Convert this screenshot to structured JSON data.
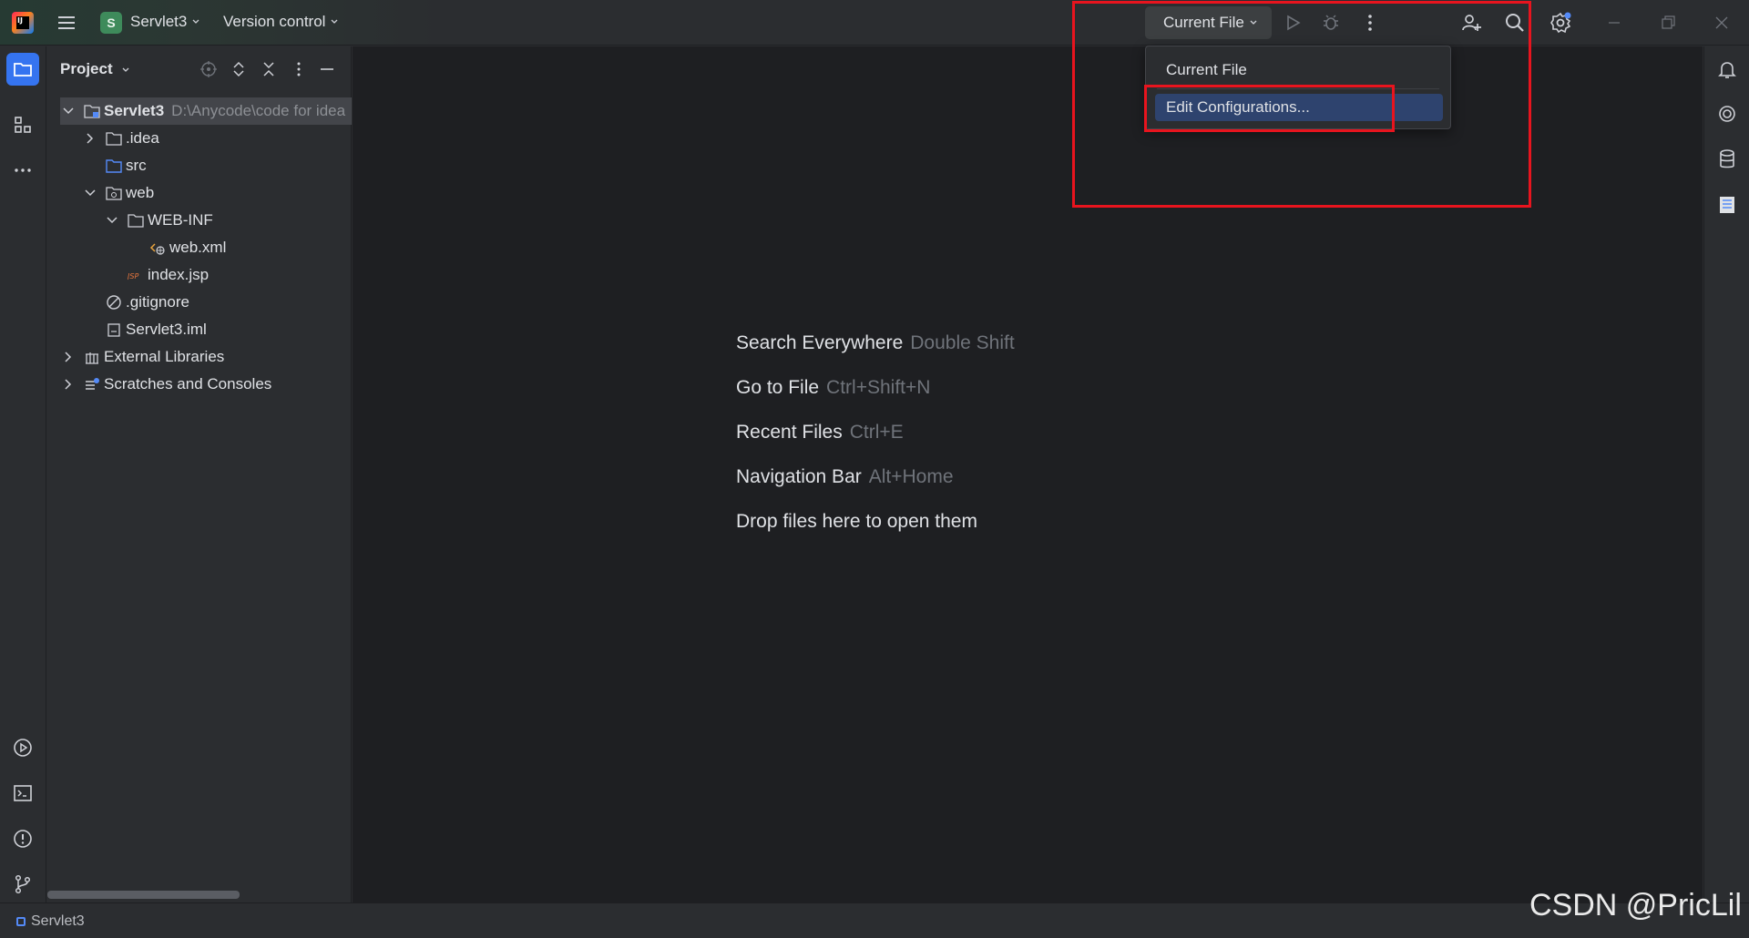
{
  "title_bar": {
    "project_badge": "S",
    "project_name": "Servlet3",
    "version_control_label": "Version control",
    "run_config_label": "Current File"
  },
  "run_config_popup": {
    "items": [
      {
        "label": "Current File",
        "selected": false
      },
      {
        "label": "Edit Configurations...",
        "selected": true
      }
    ]
  },
  "project_panel": {
    "title": "Project",
    "tree": [
      {
        "label": "Servlet3",
        "path": "D:\\Anycode\\code for idea",
        "depth": 0,
        "expanded": true,
        "icon": "module-folder-icon"
      },
      {
        "label": ".idea",
        "depth": 1,
        "expanded": false,
        "icon": "folder-icon"
      },
      {
        "label": "src",
        "depth": 1,
        "icon": "source-folder-icon"
      },
      {
        "label": "web",
        "depth": 1,
        "expanded": true,
        "icon": "web-folder-icon"
      },
      {
        "label": "WEB-INF",
        "depth": 2,
        "expanded": true,
        "icon": "folder-icon"
      },
      {
        "label": "web.xml",
        "depth": 3,
        "icon": "xml-file-icon"
      },
      {
        "label": "index.jsp",
        "depth": 2,
        "icon": "jsp-file-icon"
      },
      {
        "label": ".gitignore",
        "depth": 1,
        "icon": "ignore-file-icon"
      },
      {
        "label": "Servlet3.iml",
        "depth": 1,
        "icon": "iml-file-icon"
      },
      {
        "label": "External Libraries",
        "depth": 0,
        "expanded": false,
        "icon": "libraries-icon"
      },
      {
        "label": "Scratches and Consoles",
        "depth": 0,
        "expanded": false,
        "icon": "scratches-icon"
      }
    ]
  },
  "editor_hints": [
    {
      "action": "Search Everywhere",
      "shortcut": "Double Shift"
    },
    {
      "action": "Go to File",
      "shortcut": "Ctrl+Shift+N"
    },
    {
      "action": "Recent Files",
      "shortcut": "Ctrl+E"
    },
    {
      "action": "Navigation Bar",
      "shortcut": "Alt+Home"
    },
    {
      "action": "Drop files here to open them",
      "shortcut": ""
    }
  ],
  "status_bar": {
    "project_label": "Servlet3"
  },
  "watermark": "CSDN @PricLil",
  "colors": {
    "accent": "#3574f0",
    "annotation_red": "#e8141e",
    "selection": "#2e436e"
  }
}
